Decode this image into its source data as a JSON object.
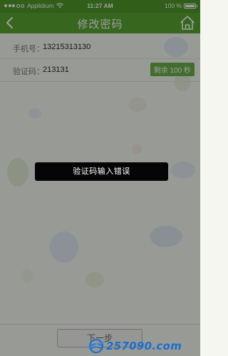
{
  "status_bar": {
    "carrier": "Applidium",
    "time": "11:27 AM",
    "battery_percent": "100 %",
    "battery_level": 1.0,
    "signal_bars": 5,
    "signal_filled": 3
  },
  "nav": {
    "title": "修改密码",
    "back_icon": "chevron-left-icon",
    "home_icon": "home-icon"
  },
  "form": {
    "phone_label": "手机号：",
    "phone_value": "13215313130",
    "code_label": "验证码：",
    "code_value": "213131",
    "resend_label": "剩余 100 秒"
  },
  "next_button_label": "下一步",
  "toast_message": "验证码输入错误",
  "watermark": {
    "text": "257090.com"
  },
  "colors": {
    "header_green": "#5aa532",
    "status_green": "#4f9a2a",
    "button_green": "#6bb04a",
    "toast_bg": "#050505",
    "watermark_blue": "#1a6fd0"
  }
}
